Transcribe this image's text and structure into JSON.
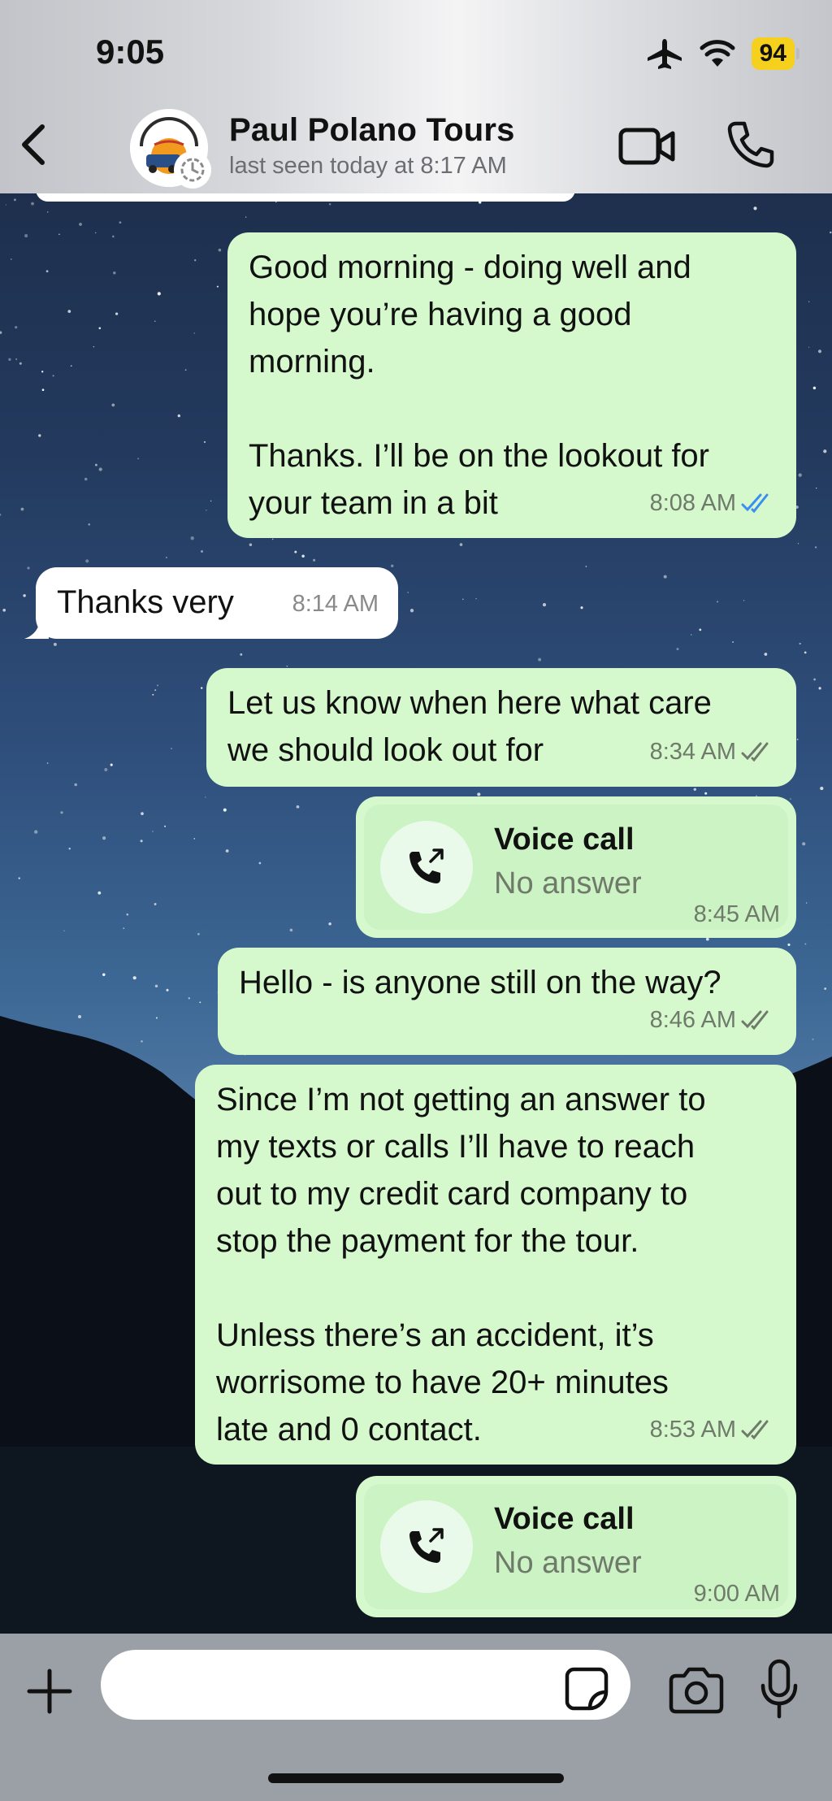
{
  "status_bar": {
    "time": "9:05",
    "battery": "94"
  },
  "header": {
    "contact_name": "Paul Polano Tours",
    "last_seen": "last seen today at 8:17 AM"
  },
  "messages": [
    {
      "direction": "out",
      "text": "Good morning - doing well and\nhope you’re having a good\nmorning.\n\nThanks. I’ll be on the lookout for\nyour team in a bit",
      "time": "8:08 AM",
      "status": "read"
    },
    {
      "direction": "in",
      "text": "Thanks very",
      "time": "8:14 AM"
    },
    {
      "direction": "out",
      "text": "Let us know when here what care\nwe should look out for",
      "time": "8:34 AM",
      "status": "delivered"
    },
    {
      "direction": "out",
      "type": "call",
      "title": "Voice call",
      "subtitle": "No answer",
      "time": "8:45 AM"
    },
    {
      "direction": "out",
      "text": "Hello - is anyone still on the way?",
      "time": "8:46 AM",
      "status": "delivered"
    },
    {
      "direction": "out",
      "text": "Since I’m not getting an answer to\nmy texts or calls I’ll have to reach\nout to my credit card company to\nstop the payment for the tour.\n\nUnless there’s an accident, it’s\nworrisome to have 20+ minutes\nlate and 0 contact.",
      "time": "8:53 AM",
      "status": "delivered"
    },
    {
      "direction": "out",
      "type": "call",
      "title": "Voice call",
      "subtitle": "No answer",
      "time": "9:00 AM"
    }
  ],
  "composer": {
    "input_value": ""
  },
  "colors": {
    "outgoing_bubble": "#d5f9cd",
    "incoming_bubble": "#ffffff",
    "read_ticks": "#3b8df0",
    "delivered_ticks": "#6f7a6b",
    "battery": "#f5d11d"
  },
  "icons": {
    "back": "chevron-left-icon",
    "video": "video-camera-icon",
    "call": "phone-icon",
    "airplane": "airplane-icon",
    "wifi": "wifi-icon",
    "plus": "plus-icon",
    "sticker": "sticker-icon",
    "camera": "camera-icon",
    "mic": "microphone-icon"
  }
}
